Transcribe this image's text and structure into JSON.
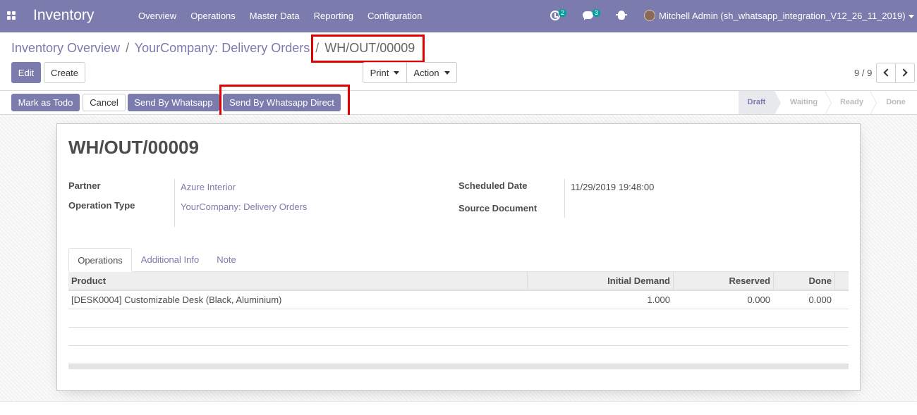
{
  "navbar": {
    "brand": "Inventory",
    "menu": [
      "Overview",
      "Operations",
      "Master Data",
      "Reporting",
      "Configuration"
    ],
    "activity_count": "2",
    "message_count": "3",
    "user": "Mitchell Admin (sh_whatsapp_integration_V12_26_11_2019)"
  },
  "breadcrumb": {
    "items": [
      "Inventory Overview",
      "YourCompany: Delivery Orders"
    ],
    "separator": "/",
    "current": "WH/OUT/00009"
  },
  "toolbar": {
    "edit_label": "Edit",
    "create_label": "Create",
    "print_label": "Print",
    "action_label": "Action",
    "pager_value": "9 / 9"
  },
  "header_buttons": {
    "mark_todo": "Mark as Todo",
    "cancel": "Cancel",
    "send_whatsapp": "Send By Whatsapp",
    "send_whatsapp_direct": "Send By Whatsapp Direct"
  },
  "statusbar": {
    "stages": [
      "Draft",
      "Waiting",
      "Ready",
      "Done"
    ],
    "active": "Draft"
  },
  "form": {
    "title": "WH/OUT/00009",
    "partner_label": "Partner",
    "partner_value": "Azure Interior",
    "operation_type_label": "Operation Type",
    "operation_type_value": "YourCompany: Delivery Orders",
    "scheduled_date_label": "Scheduled Date",
    "scheduled_date_value": "11/29/2019 19:48:00",
    "source_document_label": "Source Document",
    "source_document_value": ""
  },
  "tabs": [
    "Operations",
    "Additional Info",
    "Note"
  ],
  "table": {
    "columns": [
      "Product",
      "Initial Demand",
      "Reserved",
      "Done"
    ],
    "rows": [
      [
        "[DESK0004] Customizable Desk (Black, Aluminium)",
        "1.000",
        "0.000",
        "0.000"
      ]
    ]
  },
  "colors": {
    "brand": "#7c7bad",
    "highlight": "#e00000",
    "badge": "#00a09d"
  }
}
